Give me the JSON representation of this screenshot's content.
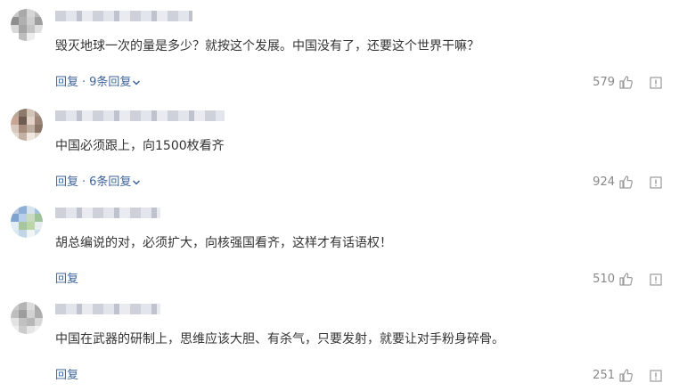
{
  "comments": [
    {
      "text": "毁灭地球一次的量是多少？就按这个发展。中国没有了，还要这个世界干嘛？",
      "reply_label": "回复",
      "separator": "·",
      "replies_label": "9条回复",
      "likes": "579",
      "avatar_palette": [
        "#c8c8c8",
        "#a9a9a9",
        "#d6d6d6",
        "#bcbcbc",
        "#8f8f8f",
        "#b0b0b0",
        "#cfcfcf",
        "#9e9e9e",
        "#d9d9d9",
        "#a5a5a5",
        "#c4c4c4",
        "#e0e0e0",
        "#ffffff",
        "#bdbdbd",
        "#ededed",
        "#ffffff"
      ]
    },
    {
      "text": "中国必须跟上，向1500枚看齐",
      "reply_label": "回复",
      "separator": "·",
      "replies_label": "6条回复",
      "likes": "924",
      "avatar_palette": [
        "#b7a69a",
        "#8c7a6d",
        "#d2c3b7",
        "#a8958a",
        "#c9a594",
        "#6e5c52",
        "#e2d2c7",
        "#9c8578",
        "#d8c8bd",
        "#a78c7e",
        "#bfae9f",
        "#8a7568",
        "#e6dbd1",
        "#c2b1a4",
        "#f0e8e0",
        "#dccdc1"
      ]
    },
    {
      "text": "胡总编说的对，必须扩大，向核强国看齐，这样才有话语权！",
      "reply_label": "回复",
      "separator": "",
      "replies_label": "",
      "likes": "510",
      "avatar_palette": [
        "#b9cbe0",
        "#8fb0d6",
        "#d7e3ef",
        "#a6c1de",
        "#7fa3cf",
        "#b9d0e6",
        "#c8dbc0",
        "#9ec39a",
        "#e2ecf4",
        "#a7c59f",
        "#bcd6a8",
        "#e9eef2",
        "#dbe8f1",
        "#c3d6e7",
        "#f0f4f7",
        "#cfe0ed"
      ]
    },
    {
      "text": "中国在武器的研制上，思维应该大胆、有杀气，只要发射，就要让对手粉身碎骨。",
      "reply_label": "回复",
      "separator": "",
      "replies_label": "",
      "likes": "251",
      "avatar_palette": [
        "#c9c9c9",
        "#b4b4b4",
        "#dcdcdc",
        "#a9a9a9",
        "#bebebe",
        "#9d9d9d",
        "#d2d2d2",
        "#aeaeae",
        "#e3e3e3",
        "#c1c1c1",
        "#b7b7b7",
        "#d8d8d8",
        "#eeeeee",
        "#cccccc",
        "#e6e6e6",
        "#f2f2f2"
      ]
    }
  ]
}
